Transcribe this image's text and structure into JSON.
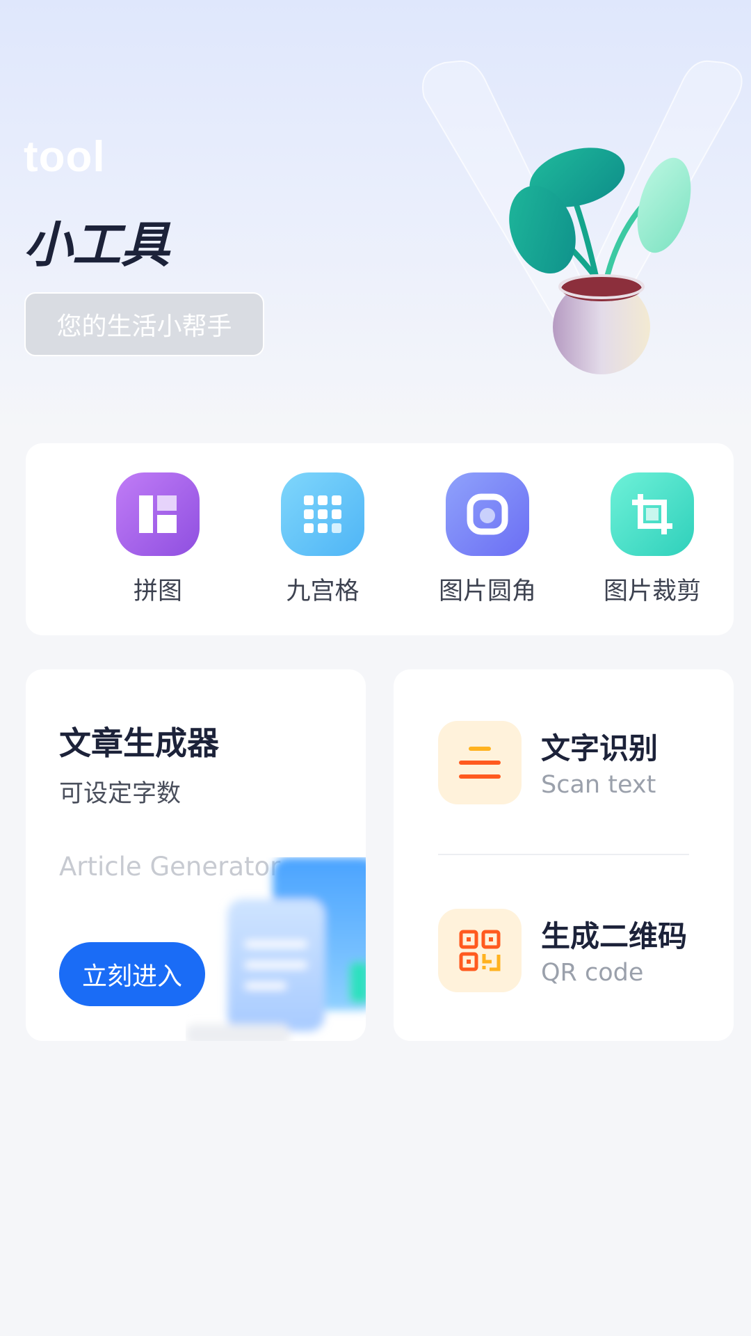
{
  "hero": {
    "tool_text": "tool",
    "title": "小工具",
    "badge": "您的生活小帮手"
  },
  "tools": [
    {
      "label": "拼图",
      "icon": "collage-icon",
      "color": "#9f5fe8"
    },
    {
      "label": "九宫格",
      "icon": "grid-nine-icon",
      "color": "#5fc2f8"
    },
    {
      "label": "图片圆角",
      "icon": "rounded-corner-icon",
      "color": "#7b82f6"
    },
    {
      "label": "图片裁剪",
      "icon": "crop-icon",
      "color": "#3fd9c4"
    }
  ],
  "article": {
    "title": "文章生成器",
    "subtitle": "可设定字数",
    "english": "Article Generator",
    "button": "立刻进入"
  },
  "features": [
    {
      "title": "文字识别",
      "subtitle": "Scan text",
      "icon": "text-lines-icon"
    },
    {
      "title": "生成二维码",
      "subtitle": "QR code",
      "icon": "qr-code-icon"
    }
  ],
  "colors": {
    "accent": "#1a6cf6",
    "orange": "#ff5a1f",
    "amber": "#ffb21f"
  }
}
